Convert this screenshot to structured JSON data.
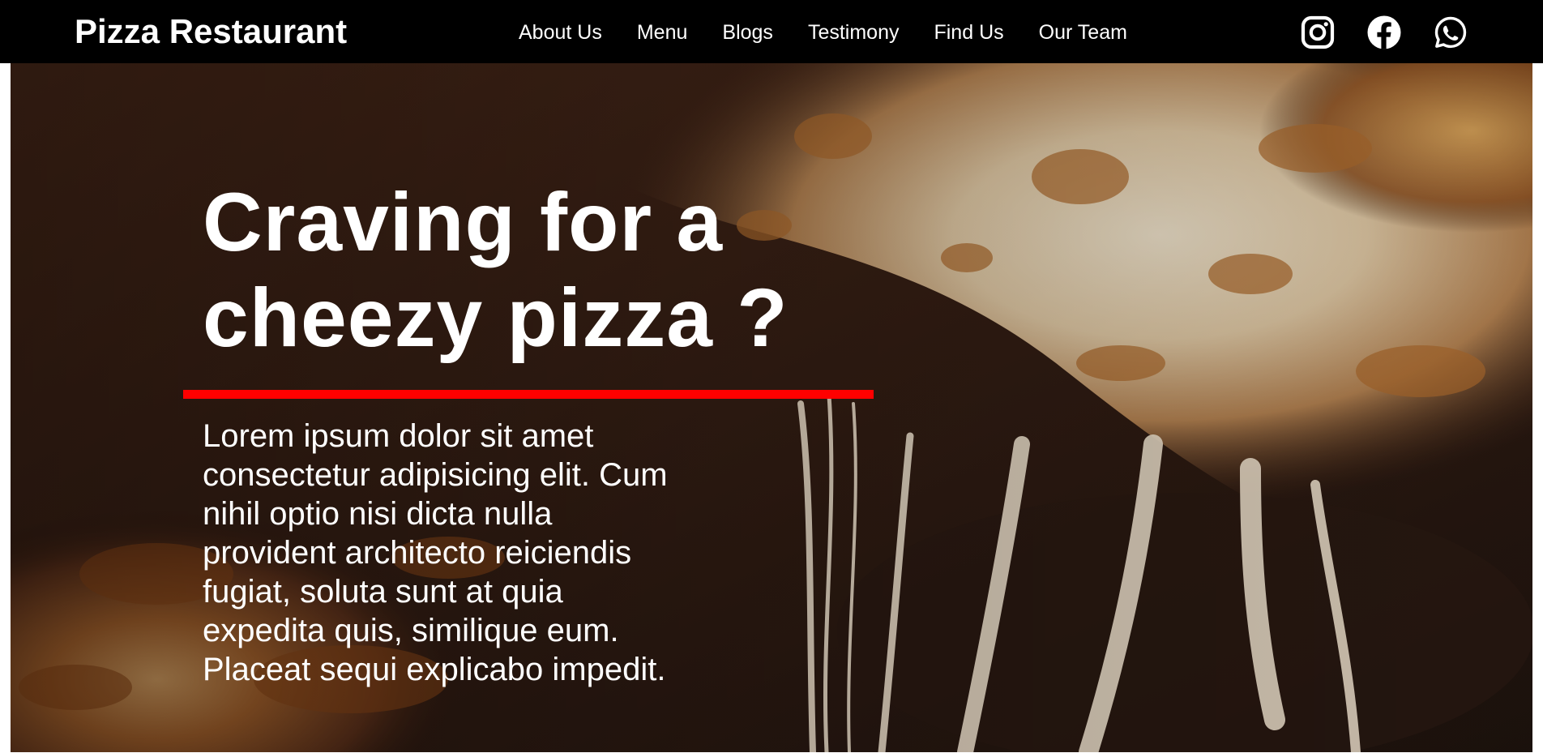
{
  "header": {
    "brand": "Pizza Restaurant",
    "nav": [
      {
        "label": "About Us"
      },
      {
        "label": "Menu"
      },
      {
        "label": "Blogs"
      },
      {
        "label": "Testimony"
      },
      {
        "label": "Find Us"
      },
      {
        "label": "Our Team"
      }
    ],
    "social": [
      "instagram-icon",
      "facebook-icon",
      "whatsapp-icon"
    ]
  },
  "hero": {
    "headline": "Craving for a cheezy pizza ?",
    "description": "Lorem ipsum dolor sit amet consectetur adipisicing elit. Cum nihil optio nisi dicta nulla provident architecto reiciendis fugiat, soluta sunt at quia expedita quis, similique eum. Placeat sequi explicabo impedit.",
    "accent_color": "#ff0000",
    "background_image": "pizza-cheese-pull-photo"
  },
  "colors": {
    "navbar": "#000000",
    "text": "#ffffff",
    "accent": "#ff0000"
  }
}
